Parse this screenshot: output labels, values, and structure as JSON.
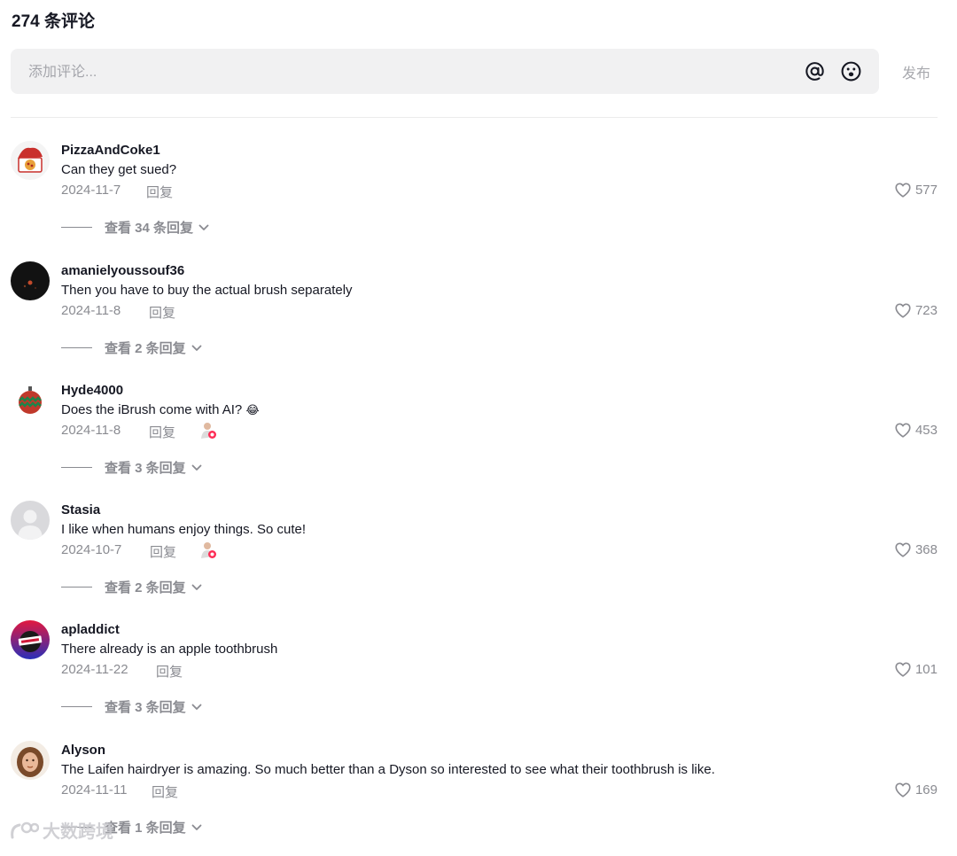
{
  "header": {
    "title": "274 条评论"
  },
  "composer": {
    "placeholder": "添加评论...",
    "at_icon": "at-icon",
    "emoji_icon": "emoji-icon",
    "post_label": "发布"
  },
  "comments": [
    {
      "username": "PizzaAndCoke1",
      "text": "Can they get sued?",
      "emoji": "",
      "date": "2024-11-7",
      "reply_label": "回复",
      "likes": "577",
      "view_replies": "查看 34 条回复",
      "creator_liked": false,
      "avatar": "pizza-avatar"
    },
    {
      "username": "amanielyoussouf36",
      "text": "Then you have to buy the actual brush separately",
      "emoji": "",
      "date": "2024-11-8",
      "reply_label": "回复",
      "likes": "723",
      "view_replies": "查看 2 条回复",
      "creator_liked": false,
      "avatar": "night-avatar"
    },
    {
      "username": "Hyde4000",
      "text": "Does the iBrush come with AI? ",
      "emoji": "😂",
      "date": "2024-11-8",
      "reply_label": "回复",
      "likes": "453",
      "view_replies": "查看 3 条回复",
      "creator_liked": true,
      "avatar": "ornament-avatar"
    },
    {
      "username": "Stasia",
      "text": "I like when humans enjoy things. So cute!",
      "emoji": "",
      "date": "2024-10-7",
      "reply_label": "回复",
      "likes": "368",
      "view_replies": "查看 2 条回复",
      "creator_liked": true,
      "avatar": "default-avatar"
    },
    {
      "username": "apladdict",
      "text": "There already is an apple toothbrush",
      "emoji": "",
      "date": "2024-11-22",
      "reply_label": "回复",
      "likes": "101",
      "view_replies": "查看 3 条回复",
      "creator_liked": false,
      "avatar": "apple-avatar"
    },
    {
      "username": "Alyson",
      "text": "The Laifen hairdryer is amazing. So much better than a Dyson so interested to see what their toothbrush is like.",
      "emoji": "",
      "date": "2024-11-11",
      "reply_label": "回复",
      "likes": "169",
      "view_replies": "查看 1 条回复",
      "creator_liked": false,
      "avatar": "memoji-avatar"
    }
  ],
  "watermark": {
    "text": "大数跨境"
  },
  "colors": {
    "text": "#161823",
    "muted": "#8a8b91",
    "input_bg": "#f1f1f2",
    "divider": "#ebebeb"
  }
}
